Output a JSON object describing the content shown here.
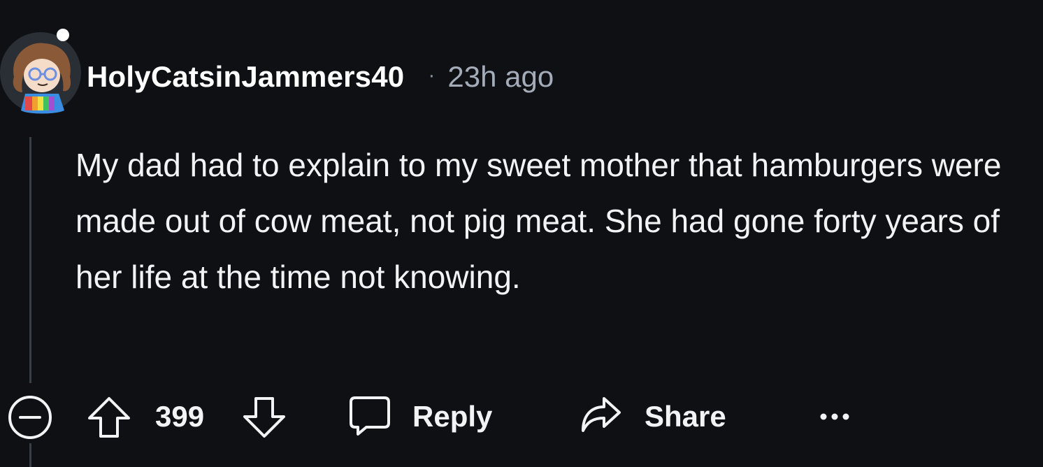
{
  "comment": {
    "author": "HolyCatsinJammers40",
    "separator": "·",
    "timestamp": "23h ago",
    "body": "My dad had to explain to my sweet mother that hamburgers were made out of cow meat, not pig meat. She had gone forty years of her life at the time not knowing."
  },
  "actions": {
    "collapse_icon": "minus-circle-icon",
    "upvote_icon": "arrow-up-outline-icon",
    "score": "399",
    "downvote_icon": "arrow-down-outline-icon",
    "reply_icon": "speech-bubble-icon",
    "reply_label": "Reply",
    "share_icon": "share-arrow-icon",
    "share_label": "Share",
    "more_icon": "ellipsis-icon"
  },
  "colors": {
    "background": "#0e1014",
    "text": "#f2f3f5",
    "muted": "#a3acb8",
    "thread_line": "#3a3f47"
  }
}
